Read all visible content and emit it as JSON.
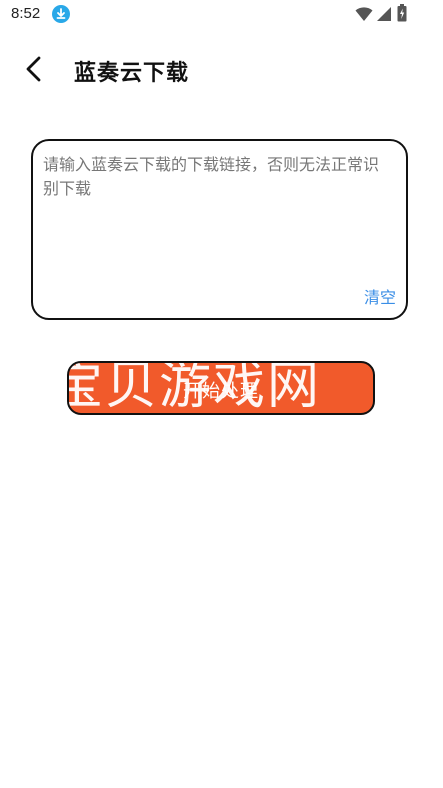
{
  "status_bar": {
    "time": "8:52",
    "icons": [
      "download-icon",
      "wifi-icon",
      "signal-icon",
      "battery-icon"
    ]
  },
  "header": {
    "back_icon": "back-arrow-icon",
    "title": "蓝奏云下载"
  },
  "link_input": {
    "placeholder": "请输入蓝奏云下载的下载链接，否则无法正常识别下载",
    "value": "",
    "clear_label": "清空"
  },
  "process_button": {
    "label": "开始处理",
    "watermark": "宝贝游戏网"
  },
  "colors": {
    "accent_blue": "#3a8ee6",
    "button_orange": "#f15a2b",
    "download_badge": "#29a8e8"
  }
}
